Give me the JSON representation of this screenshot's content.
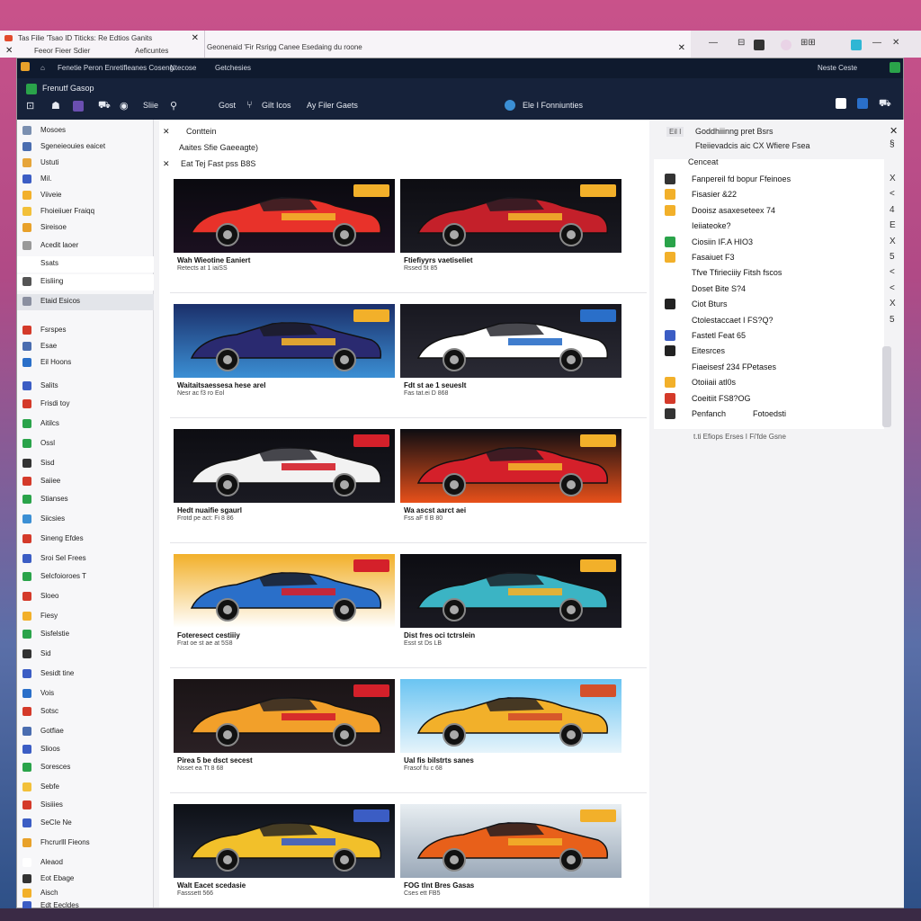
{
  "browser": {
    "tab1_title": "Tas Filie 'Tsao ID Titicks: Re Edtios Ganits",
    "tab1_sub": "Feeor Fieer Sdier",
    "tab1_sub2": "Aeficuntes",
    "tab2_title": "Geonenaid 'Fir Rsrigg Canee Esedaing du roone"
  },
  "app": {
    "menu": [
      "Fenetie Peron Enretifleanes Coseng",
      "Ntecose",
      "Getchesies"
    ],
    "menu_right": "Neste Ceste",
    "brand": "Frenutf Gasop",
    "tools": [
      "Gost",
      "Gilt Icos",
      "Ay Filer Gaets"
    ],
    "center_label": "Ele I Fonniunties",
    "status_colors": {
      "accent": "#2a6fc9",
      "top": "#16223a"
    }
  },
  "sidebar": {
    "items": [
      {
        "label": "Mosoes",
        "icon": "grid-icon",
        "color": "#7a8fb0"
      },
      {
        "label": "Sgeneieouies eaicet",
        "icon": "list-icon",
        "color": "#4a6db0"
      },
      {
        "label": "Ustuti",
        "icon": "doc-icon",
        "color": "#e6a53a"
      },
      {
        "label": "Mil.",
        "icon": "mail-icon",
        "color": "#3b5dc4"
      },
      {
        "label": "Viiveie",
        "icon": "flag-icon",
        "color": "#f2b02a"
      },
      {
        "label": "Fhoieiiuer Fraiqq",
        "icon": "folder-icon",
        "color": "#f2c03a"
      },
      {
        "label": "Sireisoe",
        "icon": "star-icon",
        "color": "#e8a12a"
      },
      {
        "label": "Acedit laoer",
        "icon": "pin-icon",
        "color": "#999999"
      },
      {
        "label": "Ssats",
        "icon": "none",
        "color": "#ffffff"
      },
      {
        "label": "Eisliing",
        "icon": "book-icon",
        "color": "#555555"
      },
      {
        "label": "Etaid Esicos",
        "icon": "tag-icon",
        "color": "#8a8fa0"
      },
      {
        "label": "Fsrspes",
        "icon": "car-icon",
        "color": "#d43a2a"
      },
      {
        "label": "Esae",
        "icon": "chart-icon",
        "color": "#4a6db0"
      },
      {
        "label": "Eil Hoons",
        "icon": "box-icon",
        "color": "#2a6fc9"
      },
      {
        "label": "Salits",
        "icon": "bolt-icon",
        "color": "#3b5dc4"
      },
      {
        "label": "Frisdi toy",
        "icon": "tag-red-icon",
        "color": "#d43a2a"
      },
      {
        "label": "Aitilcs",
        "icon": "leaf-icon",
        "color": "#2aa34a"
      },
      {
        "label": "Ossl",
        "icon": "home-icon",
        "color": "#2aa34a"
      },
      {
        "label": "Sisd",
        "icon": "sound-icon",
        "color": "#333333"
      },
      {
        "label": "Saiiee",
        "icon": "red-icon",
        "color": "#d43a2a"
      },
      {
        "label": "Stianses",
        "icon": "check-icon",
        "color": "#2aa34a"
      },
      {
        "label": "Siicsies",
        "icon": "cloud-icon",
        "color": "#3b8fd4"
      },
      {
        "label": "Sineng Efdes",
        "icon": "pin2-icon",
        "color": "#d43a2a"
      },
      {
        "label": "Sroi Sel Frees",
        "icon": "car2-icon",
        "color": "#3b5dc4"
      },
      {
        "label": "Selcfoioroes T",
        "icon": "t-icon",
        "color": "#2aa34a"
      },
      {
        "label": "Sloeo",
        "icon": "dot-icon",
        "color": "#d43a2a"
      },
      {
        "label": "Fiesy",
        "icon": "flag2-icon",
        "color": "#f2b02a"
      },
      {
        "label": "Sisfelstie",
        "icon": "grid2-icon",
        "color": "#2aa34a"
      },
      {
        "label": "Sid",
        "icon": "s-icon",
        "color": "#333333"
      },
      {
        "label": "Sesidt tine",
        "icon": "chat-icon",
        "color": "#3b5dc4"
      },
      {
        "label": "Vois",
        "icon": "link-icon",
        "color": "#2a6fc9"
      },
      {
        "label": "Sotsc",
        "icon": "dice-icon",
        "color": "#d43a2a"
      },
      {
        "label": "Gotfiae",
        "icon": "pipe-icon",
        "color": "#4a6db0"
      },
      {
        "label": "Slioos",
        "icon": "bar-icon",
        "color": "#3b5dc4"
      },
      {
        "label": "Soresces",
        "icon": "g-icon",
        "color": "#2aa34a"
      },
      {
        "label": "Sebfe",
        "icon": "y-icon",
        "color": "#f2c03a"
      },
      {
        "label": "Sisiiies",
        "icon": "x-icon",
        "color": "#d43a2a"
      },
      {
        "label": "SeCIe Ne",
        "icon": "car3-icon",
        "color": "#3b5dc4"
      },
      {
        "label": "Fhcrurlll Fieons",
        "icon": "fire-icon",
        "color": "#e8a12a"
      },
      {
        "label": "Aleaod",
        "icon": "none2",
        "color": "#ffffff"
      },
      {
        "label": "Eot Ebage",
        "icon": "bd-icon",
        "color": "#333333"
      },
      {
        "label": "Aisch",
        "icon": "tag3-icon",
        "color": "#f2b02a"
      },
      {
        "label": "Edt Eecldes",
        "icon": "net-icon",
        "color": "#3b5dc4"
      }
    ]
  },
  "content": {
    "header": "Conttein",
    "sub": "Aaites Sfie Gaeeagte)",
    "filter": "Eat Tej Fast pss B8S",
    "cards": [
      {
        "title": "Wah Wieotine Eaniert",
        "meta": "Retects at 1 iaiSS",
        "theme": "logo-dark"
      },
      {
        "title": "Ftiefiyyrs vaetiseliet",
        "meta": "Rssed 5t 85",
        "theme": "red"
      },
      {
        "title": "Waitaitsaessesa hese arel",
        "meta": "Nesr ac f3 ro Eol",
        "theme": "blue"
      },
      {
        "title": "Fdt st ae 1 seueslt",
        "meta": "Fas tat.ei D 868",
        "theme": "white"
      },
      {
        "title": "Hedt nuaifie sgaurl",
        "meta": "Frotd pe act: Fi 8 86",
        "theme": "white-dark"
      },
      {
        "title": "Wa ascst aarct aei",
        "meta": "Fss aF tl B 80",
        "theme": "orange"
      },
      {
        "title": "Foteresect cestiiiy",
        "meta": "Frat oe st ae at 5S8",
        "theme": "yellow"
      },
      {
        "title": "Dist fres oci tctrslein",
        "meta": "Esst st Ds LB",
        "theme": "teal"
      },
      {
        "title": "Pirea 5 be dsct secest",
        "meta": "Nsset ea Tt 8 68",
        "theme": "flame"
      },
      {
        "title": "Ual fis bilstrts sanes",
        "meta": "Frasof fu c 68",
        "theme": "sky"
      },
      {
        "title": "Walt Eacet scedasie",
        "meta": "Fasssett 566",
        "theme": "night"
      },
      {
        "title": "FOG tlnt Bres Gasas",
        "meta": "Cses ett FB5",
        "theme": "smoke"
      }
    ]
  },
  "rpanel": {
    "header1": "Goddhiiinng pret Bsrs",
    "header2": "Fteiievadcis aic CX Wfiere Fsea",
    "filter_label": "Eil I",
    "list_header": "Cenceat",
    "items": [
      {
        "label": "Fanpereil fd bopur Ffeinoes",
        "icon": "car-icon",
        "color": "#333333",
        "action": "X"
      },
      {
        "label": "Fisasier &22",
        "icon": "yellow-icon",
        "color": "#f2b02a",
        "action": "<"
      },
      {
        "label": "Dooisz asaxeseteex 74",
        "icon": "yellow2-icon",
        "color": "#f2b02a",
        "action": "4"
      },
      {
        "label": "Ieiiateoke?",
        "icon": "none",
        "color": "#ffffff",
        "action": "E"
      },
      {
        "label": "Ciosiin IF.A HIO3",
        "icon": "green-icon",
        "color": "#2aa34a",
        "action": "X"
      },
      {
        "label": "Fasaiuet F3",
        "icon": "orange-icon",
        "color": "#f2b02a",
        "action": "5"
      },
      {
        "label": "Tfve Tfirieciiiy Fitsh fscos",
        "icon": "none",
        "color": "#ffffff",
        "action": "<"
      },
      {
        "label": "Doset Bite S?4",
        "icon": "none",
        "color": "#ffffff",
        "action": "<"
      },
      {
        "label": "Ciot Bturs",
        "icon": "bolt-icon",
        "color": "#222222",
        "action": "X"
      },
      {
        "label": "Ctolestaccaet I FS?Q?",
        "icon": "none",
        "color": "#ffffff",
        "action": "5"
      },
      {
        "label": "Fastetl Feat 65",
        "icon": "car-icon",
        "color": "#3b5dc4",
        "action": ""
      },
      {
        "label": "Eitesrces",
        "icon": "q-icon",
        "color": "#222222",
        "action": ""
      },
      {
        "label": "Fiaeisesf 234 FPetases",
        "icon": "none",
        "color": "#ffffff",
        "action": ""
      },
      {
        "label": "Otoiiaii atl0s",
        "icon": "orange2-icon",
        "color": "#f2b02a",
        "action": ""
      },
      {
        "label": "Coeitiit FS8?OG",
        "icon": "red-icon",
        "color": "#d43a2a",
        "action": ""
      },
      {
        "label": "Penfanch",
        "link": "Fotoedsti",
        "icon": "car4-icon",
        "color": "#333333",
        "action": ""
      }
    ],
    "footer": "t.ti Efiops  Erses  I  Fi'fde Gsne"
  }
}
